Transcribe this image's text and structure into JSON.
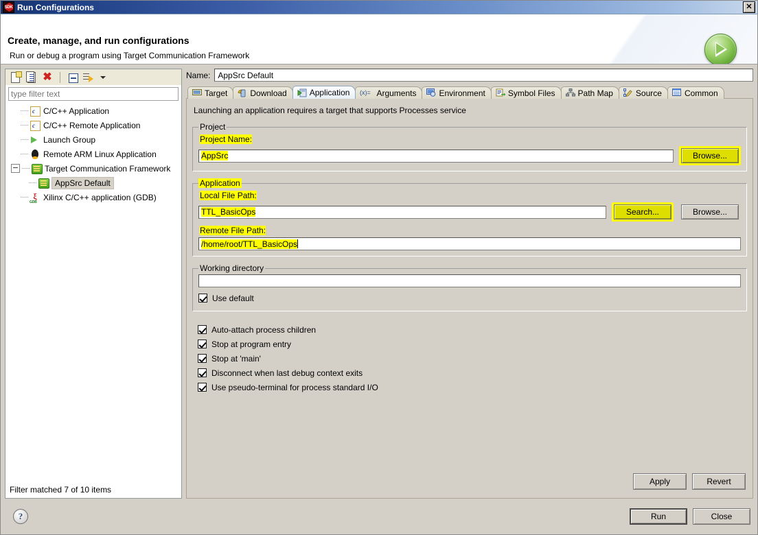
{
  "window": {
    "title": "Run Configurations",
    "app_icon": "sdk-icon",
    "close_label": "✕"
  },
  "banner": {
    "title": "Create, manage, and run configurations",
    "subtitle": "Run or debug a program using Target Communication Framework",
    "icon": "run-green-icon"
  },
  "left_panel": {
    "toolbar": [
      {
        "name": "new-configuration-icon",
        "tooltip": "New launch configuration"
      },
      {
        "name": "duplicate-configuration-icon",
        "tooltip": "Duplicate"
      },
      {
        "name": "delete-configuration-icon",
        "tooltip": "Delete"
      },
      {
        "name": "collapse-all-icon",
        "tooltip": "Collapse All"
      },
      {
        "name": "filter-icon",
        "tooltip": "Filter"
      },
      {
        "name": "chevron-down-icon",
        "tooltip": "Menu"
      }
    ],
    "filter": {
      "placeholder": "type filter text",
      "value": ""
    },
    "tree": [
      {
        "label": "C/C++ Application",
        "icon": "c-file-icon",
        "indent": 0,
        "expander": "none",
        "selected": false
      },
      {
        "label": "C/C++ Remote Application",
        "icon": "c-file-icon",
        "indent": 0,
        "expander": "none",
        "selected": false
      },
      {
        "label": "Launch Group",
        "icon": "play-green-icon",
        "indent": 0,
        "expander": "none",
        "selected": false
      },
      {
        "label": "Remote ARM Linux Application",
        "icon": "tux-icon",
        "indent": 0,
        "expander": "none",
        "selected": false
      },
      {
        "label": "Target Communication Framework",
        "icon": "tcf-icon",
        "indent": 0,
        "expander": "expanded",
        "selected": false
      },
      {
        "label": "AppSrc Default",
        "icon": "tcf-icon",
        "indent": 1,
        "expander": "none",
        "selected": true
      },
      {
        "label": "Xilinx C/C++ application (GDB)",
        "icon": "gdb-icon",
        "indent": 0,
        "expander": "none",
        "selected": false
      }
    ],
    "status": "Filter matched 7 of 10 items"
  },
  "right_panel": {
    "name_label": "Name:",
    "name_value": "AppSrc Default",
    "tabs": [
      {
        "label": "Target",
        "icon": "target-icon",
        "active": false
      },
      {
        "label": "Download",
        "icon": "download-icon",
        "active": false
      },
      {
        "label": "Application",
        "icon": "application-icon",
        "active": true
      },
      {
        "label": "Arguments",
        "icon": "arguments-icon",
        "active": false
      },
      {
        "label": "Environment",
        "icon": "environment-icon",
        "active": false
      },
      {
        "label": "Symbol Files",
        "icon": "symbol-files-icon",
        "active": false
      },
      {
        "label": "Path Map",
        "icon": "path-map-icon",
        "active": false
      },
      {
        "label": "Source",
        "icon": "source-icon",
        "active": false
      },
      {
        "label": "Common",
        "icon": "common-icon",
        "active": false
      }
    ],
    "hint": "Launching an application requires a target that supports Processes service",
    "project_group": {
      "legend": "Project",
      "field_label": "Project Name:",
      "value": "AppSrc",
      "browse_label": "Browse..."
    },
    "application_group": {
      "legend": "Application",
      "local_label": "Local File Path:",
      "local_value": "TTL_BasicOps",
      "search_label": "Search...",
      "browse_label": "Browse...",
      "remote_label": "Remote File Path:",
      "remote_value": "/home/root/TTL_BasicOps"
    },
    "working_dir_group": {
      "legend": "Working directory",
      "value": "",
      "use_default_label": "Use default",
      "use_default_checked": true
    },
    "checkboxes": [
      {
        "label": "Auto-attach process children",
        "checked": true
      },
      {
        "label": "Stop at program entry",
        "checked": true
      },
      {
        "label": "Stop at 'main'",
        "checked": true
      },
      {
        "label": "Disconnect when last debug context exits",
        "checked": true
      },
      {
        "label": "Use pseudo-terminal for process standard I/O",
        "checked": true
      }
    ],
    "apply_label": "Apply",
    "revert_label": "Revert"
  },
  "footer": {
    "help_icon": "help-icon",
    "help_glyph": "?",
    "run_label": "Run",
    "close_label": "Close"
  },
  "colors": {
    "highlight": "#ffff00",
    "titlebar_start": "#15326e",
    "titlebar_end": "#c8d8ec",
    "dialog_bg": "#d4d0c8",
    "accent_green": "#65ab35"
  }
}
